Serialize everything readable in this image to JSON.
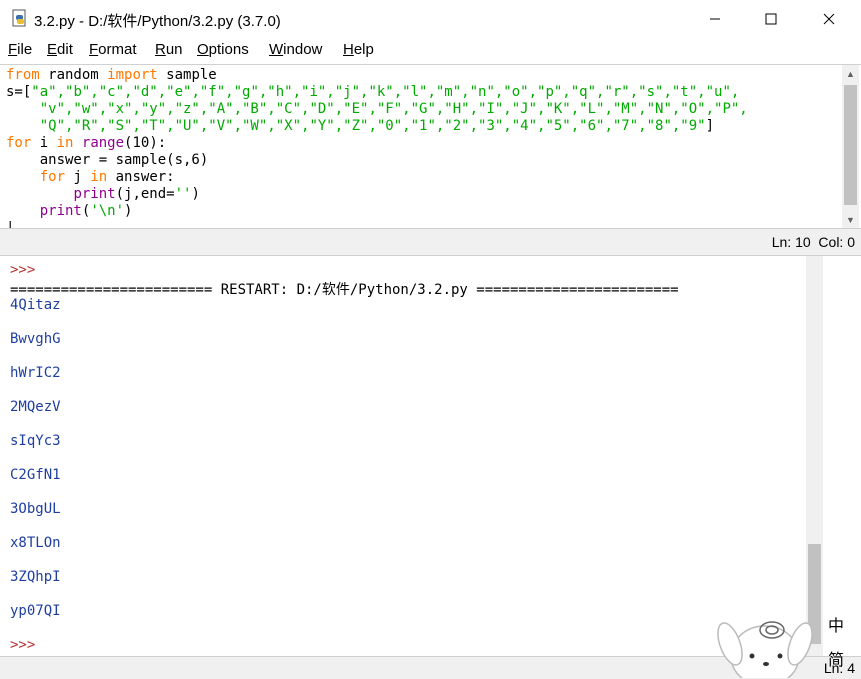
{
  "window": {
    "title": "3.2.py - D:/软件/Python/3.2.py (3.7.0)",
    "minimize_glyph": "—",
    "maximize_glyph": "☐",
    "close_glyph": "✕",
    "app_icon": "python-file-icon"
  },
  "menu": {
    "items": [
      {
        "mn": "F",
        "rest": "ile"
      },
      {
        "mn": "E",
        "rest": "dit"
      },
      {
        "mn": "F",
        "rest": "ormat",
        "pre": ""
      },
      {
        "mn": "R",
        "rest": "un"
      },
      {
        "mn": "O",
        "rest": "ptions"
      },
      {
        "mn": "W",
        "rest": "indow"
      },
      {
        "mn": "H",
        "rest": "elp"
      }
    ]
  },
  "editor": {
    "lines": [
      [
        {
          "t": "from",
          "c": "kw"
        },
        {
          "t": " random "
        },
        {
          "t": "import",
          "c": "kw"
        },
        {
          "t": " sample"
        }
      ],
      [
        {
          "t": "s=["
        },
        {
          "t": "\"a\",\"b\",\"c\",\"d\",\"e\",\"f\",\"g\",\"h\",\"i\",\"j\",\"k\",\"l\",\"m\",\"n\",\"o\",\"p\",\"q\",\"r\",\"s\",\"t\",\"u\",",
          "c": "str"
        }
      ],
      [
        {
          "t": "    "
        },
        {
          "t": "\"v\",\"w\",\"x\",\"y\",\"z\",\"A\",\"B\",\"C\",\"D\",\"E\",\"F\",\"G\",\"H\",\"I\",\"J\",\"K\",\"L\",\"M\",\"N\",\"O\",\"P\",",
          "c": "str"
        }
      ],
      [
        {
          "t": "    "
        },
        {
          "t": "\"Q\",\"R\",\"S\",\"T\",\"U\",\"V\",\"W\",\"X\",\"Y\",\"Z\",\"0\",\"1\",\"2\",\"3\",\"4\",\"5\",\"6\",\"7\",\"8\",\"9\"",
          "c": "str"
        },
        {
          "t": "]"
        }
      ],
      [
        {
          "t": "for",
          "c": "kw"
        },
        {
          "t": " i "
        },
        {
          "t": "in",
          "c": "kw"
        },
        {
          "t": " "
        },
        {
          "t": "range",
          "c": "bi"
        },
        {
          "t": "(10):"
        }
      ],
      [
        {
          "t": "    answer = sample(s,6)"
        }
      ],
      [
        {
          "t": "    "
        },
        {
          "t": "for",
          "c": "kw"
        },
        {
          "t": " j "
        },
        {
          "t": "in",
          "c": "kw"
        },
        {
          "t": " answer:"
        }
      ],
      [
        {
          "t": "        "
        },
        {
          "t": "print",
          "c": "bi"
        },
        {
          "t": "(j,end="
        },
        {
          "t": "''",
          "c": "str"
        },
        {
          "t": ")"
        }
      ],
      [
        {
          "t": "    "
        },
        {
          "t": "print",
          "c": "bi"
        },
        {
          "t": "("
        },
        {
          "t": "'\\n'",
          "c": "str"
        },
        {
          "t": ")"
        }
      ],
      [
        {
          "t": "|"
        }
      ]
    ]
  },
  "status": {
    "editor_position": "Ln: 10  Col: 0",
    "shell_position": "Ln: 4"
  },
  "shell": {
    "prompt": ">>>",
    "restart_line": "======================== RESTART: D:/软件/Python/3.2.py ========================",
    "outputs": [
      "4Qitaz",
      "BwvghG",
      "hWrIC2",
      "2MQezV",
      "sIqYc3",
      "C2GfN1",
      "3ObgUL",
      "x8TLOn",
      "3ZQhpI",
      "yp07QI"
    ],
    "final_prompt": ">>>"
  },
  "ime": {
    "lang": "中",
    "mode": "简"
  }
}
